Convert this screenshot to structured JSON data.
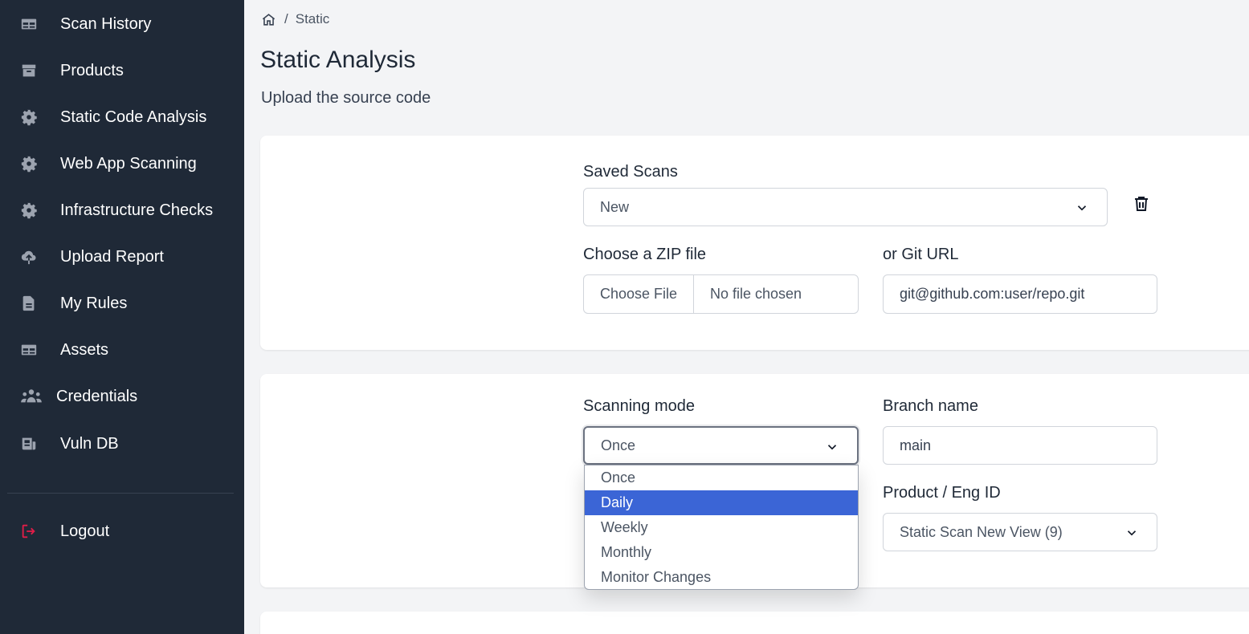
{
  "sidebar": {
    "items": [
      {
        "label": "Scan History",
        "icon": "table-icon"
      },
      {
        "label": "Products",
        "icon": "archive-icon"
      },
      {
        "label": "Static Code Analysis",
        "icon": "gear-icon"
      },
      {
        "label": "Web App Scanning",
        "icon": "gear-icon"
      },
      {
        "label": "Infrastructure Checks",
        "icon": "gear-icon"
      },
      {
        "label": "Upload Report",
        "icon": "cloud-upload-icon"
      },
      {
        "label": "My Rules",
        "icon": "document-icon"
      },
      {
        "label": "Assets",
        "icon": "table-icon"
      },
      {
        "label": "Credentials",
        "icon": "users-icon"
      },
      {
        "label": "Vuln DB",
        "icon": "newspaper-icon"
      }
    ],
    "logout": {
      "label": "Logout",
      "icon": "logout-icon"
    }
  },
  "breadcrumb": {
    "separator": "/",
    "current": "Static"
  },
  "page": {
    "title": "Static Analysis",
    "subtitle": "Upload the source code"
  },
  "saved_scans": {
    "label": "Saved Scans",
    "value": "New"
  },
  "zip": {
    "label": "Choose a ZIP file",
    "button": "Choose File",
    "status": "No file chosen"
  },
  "git": {
    "label": "or Git URL",
    "placeholder": "git@github.com:user/repo.git"
  },
  "scanning_mode": {
    "label": "Scanning mode",
    "value": "Once",
    "options": [
      "Once",
      "Daily",
      "Weekly",
      "Monthly",
      "Monitor Changes"
    ],
    "highlighted": "Daily"
  },
  "branch": {
    "label": "Branch name",
    "placeholder": "main"
  },
  "product": {
    "label": "Product / Eng ID",
    "value": "Static Scan New View (9)"
  },
  "colors": {
    "sidebar_bg": "#1f2937",
    "page_bg": "#f3f4f6",
    "highlight": "#3b65d6",
    "logout": "#e11d48"
  }
}
